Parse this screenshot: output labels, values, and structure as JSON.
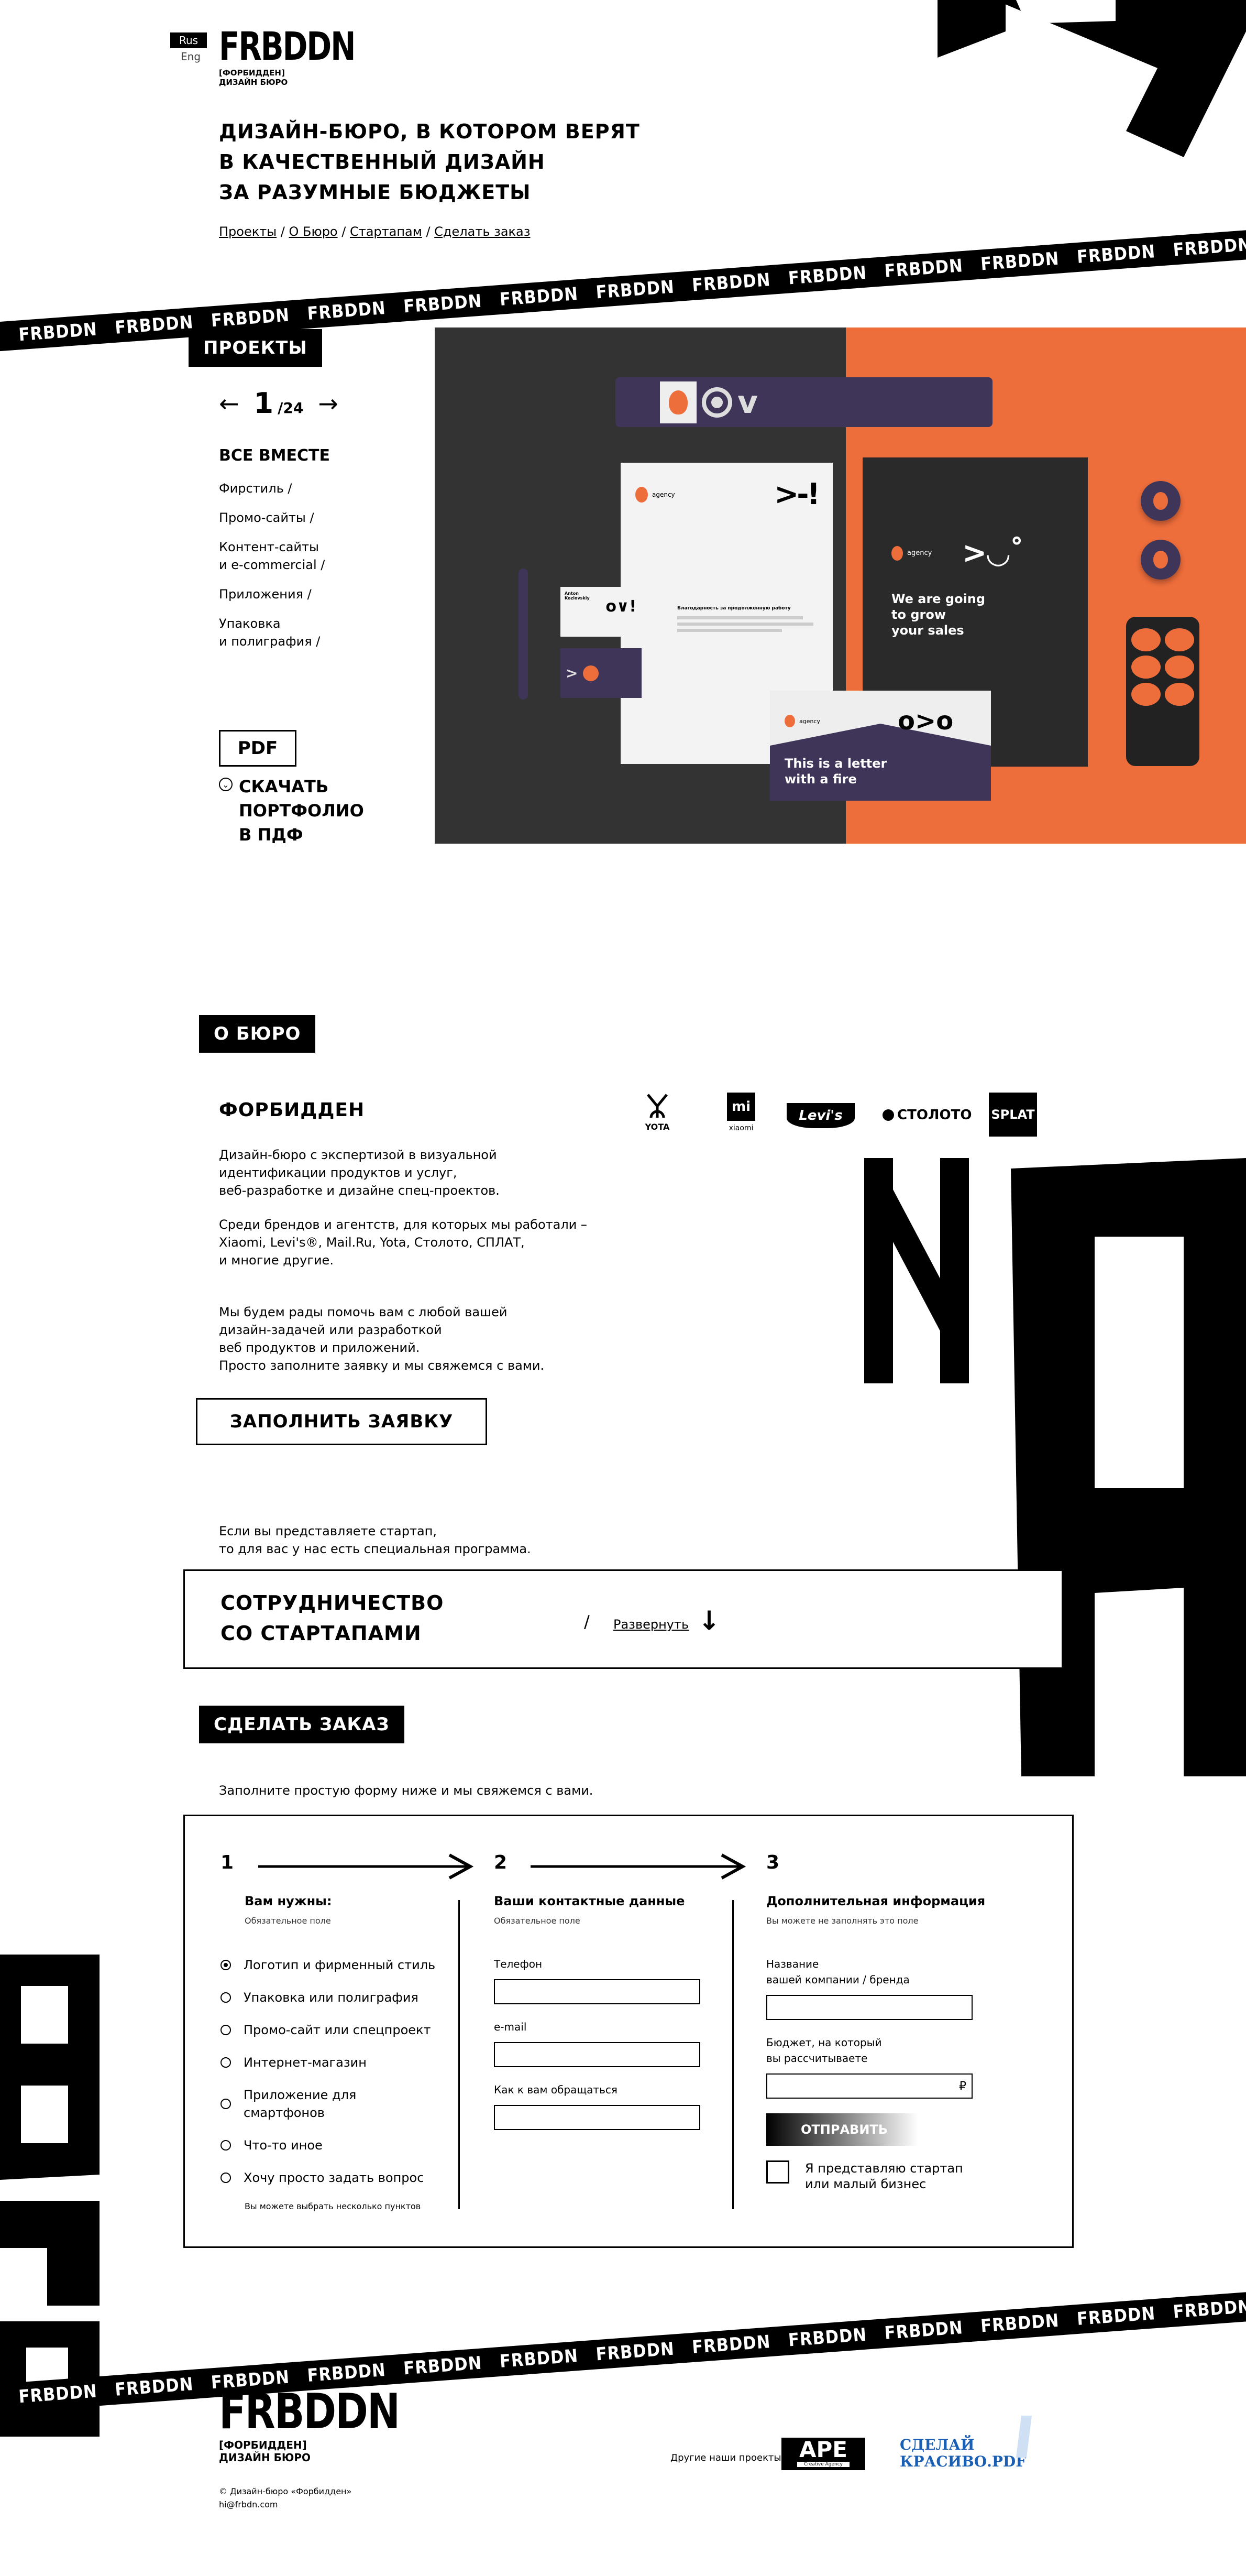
{
  "header": {
    "lang_active": "Rus",
    "lang_other": "Eng",
    "logo_text": "FRBDDN",
    "logo_sub1": "[ФОРБИДДЕН]",
    "logo_sub2": "ДИЗАЙН БЮРО",
    "headline_1": "ДИЗАЙН-БЮРО, В КОТОРОМ ВЕРЯТ",
    "headline_2": "В КАЧЕСТВЕННЫЙ ДИЗАЙН",
    "headline_3": "ЗА РАЗУМНЫЕ БЮДЖЕТЫ",
    "crumbs": [
      "Проекты",
      "О Бюро",
      "Стартапам",
      "Сделать заказ"
    ],
    "crumb_sep": " / "
  },
  "ticker_word": "FRBDDN",
  "projects": {
    "tag": "ПРОЕКТЫ",
    "page_current": "1",
    "page_total": "/24",
    "categories_title": "ВСЕ ВМЕСТЕ",
    "categories": [
      "Фирстиль /",
      "Промо-сайты /",
      "Контент-сайты\nи e-commercial /",
      "Приложения /",
      "Упаковка\nи полиграфия /"
    ],
    "pdf_label": "PDF",
    "download_label": "СКАЧАТЬ\nПОРТФОЛИО\nВ ПДФ",
    "mockup": {
      "agency": "agency",
      "poster_text": "We are going\nto grow\nyour sales",
      "envelope_text": "This is a letter\nwith a fire",
      "letter_heading": "Благодарность за продолженную работу",
      "card_name": "Anton\nKozlovskiy",
      "colors": {
        "dark": "#333333",
        "orange": "#ED6D3B",
        "purple": "#3F3558"
      }
    }
  },
  "about": {
    "tag": "О БЮРО",
    "title": "ФОРБИДДЕН",
    "p1": "Дизайн-бюро с экспертизой в визуальной\nидентификации продуктов и услуг,\nвеб-разработке и дизайне спец-проектов.",
    "p2": "Среди брендов и агентств, для которых мы работали –\nXiaomi, Levi's®, Mail.Ru, Yota, Столото, СПЛАТ,\nи многие другие.",
    "p3": "Мы будем рады помочь вам с любой вашей\nдизайн-задачей или разработкой\nвеб продуктов и приложений.\nПросто заполните заявку и мы свяжемся с вами.",
    "cta": "ЗАПОЛНИТЬ ЗАЯВКУ",
    "clients": [
      "YOTA",
      "xiaomi",
      "Levi's",
      "СТОЛОТО",
      "SPLAT"
    ]
  },
  "startups": {
    "intro": "Если вы представляете стартап,\nто для вас у нас есть специальная программа.",
    "title": "СОТРУДНИЧЕСТВО\nСО СТАРТАПАМИ",
    "slash": "/",
    "expand": "Развернуть"
  },
  "order": {
    "tag": "СДЕЛАТЬ ЗАКАЗ",
    "intro": "Заполните простую форму ниже и мы свяжемся с вами.",
    "steps": [
      "1",
      "2",
      "3"
    ],
    "col1": {
      "title": "Вам нужны:",
      "hint": "Обязательное поле",
      "options": [
        "Логотип и фирменный стиль",
        "Упаковка или полиграфия",
        "Промо-сайт или спецпроект",
        "Интернет-магазин",
        "Приложение для\nсмартфонов",
        "Что-то иное",
        "Хочу просто задать вопрос"
      ],
      "footer": "Вы можете выбрать несколько пунктов"
    },
    "col2": {
      "title": "Ваши контактные данные",
      "hint": "Обязательное поле",
      "fields": [
        "Телефон",
        "e-mail",
        "Как к вам обращаться"
      ]
    },
    "col3": {
      "title": "Дополнительная информация",
      "hint": "Вы можете не заполнять это поле",
      "field1": "Название\nвашей компании / бренда",
      "field2": "Бюджет, на который\nвы рассчитываете",
      "currency": "₽",
      "submit": "ОТПРАВИТЬ",
      "startup_check": "Я представляю стартап\nили малый бизнес"
    }
  },
  "footer": {
    "logo_text": "FRBDDN",
    "logo_sub1": "[ФОРБИДДЕН]",
    "logo_sub2": "ДИЗАЙН БЮРО",
    "copyright": "© Дизайн-бюро «Форбидден»",
    "email": "hi@frbdn.com",
    "other_projects": "Другие наши проекты:",
    "ape": "APE",
    "ape_sub": "Creative Agency",
    "pdf_project": "СДЕЛАЙ\nКРАСИВО.PDF"
  }
}
